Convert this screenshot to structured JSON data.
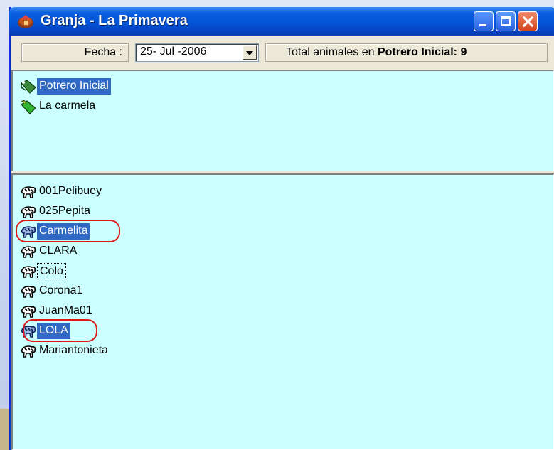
{
  "window": {
    "title": "Granja - La Primavera"
  },
  "toolbar": {
    "fecha_label": "Fecha :",
    "fecha_value": "25- Jul -2006",
    "total_prefix": "Total animales en",
    "total_location": "Potrero Inicial:",
    "total_count": "9"
  },
  "potreros": [
    {
      "label": "Potrero Inicial",
      "selected": true
    },
    {
      "label": "La carmela",
      "selected": false
    }
  ],
  "animales": [
    {
      "label": "001Pelibuey",
      "selected": false
    },
    {
      "label": "025Pepita",
      "selected": false
    },
    {
      "label": "Carmelita",
      "selected": true,
      "circled": true
    },
    {
      "label": "CLARA",
      "selected": false
    },
    {
      "label": "Colo",
      "selected": false,
      "focused": true
    },
    {
      "label": "Corona1",
      "selected": false
    },
    {
      "label": "JuanMa01",
      "selected": false
    },
    {
      "label": "LOLA",
      "selected": true,
      "circled": true
    },
    {
      "label": "Mariantonieta",
      "selected": false
    }
  ],
  "colors": {
    "titlebar": "#0254d6",
    "list_background": "#ccffff",
    "selection": "#316ac5",
    "annotation_circle": "#e01818"
  },
  "icons": {
    "app": "farm-icon",
    "potrero": "pasture-icon",
    "animal": "animal-icon"
  }
}
